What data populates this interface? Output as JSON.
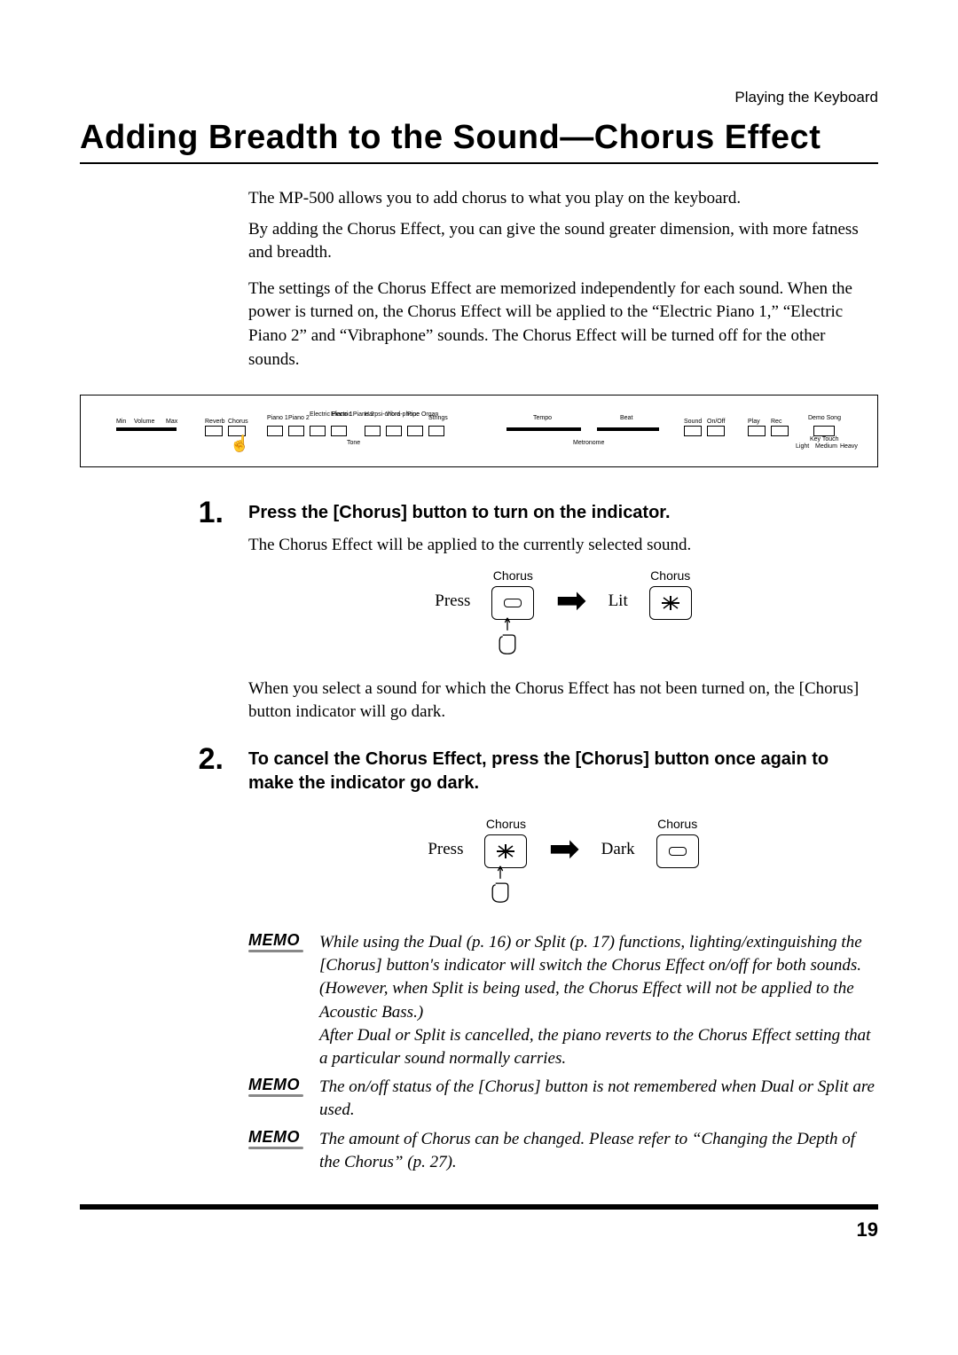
{
  "breadcrumb": "Playing the Keyboard",
  "title": "Adding Breadth to the Sound—Chorus Effect",
  "intro": {
    "p1": "The MP-500 allows you to add chorus to what you play on the keyboard.",
    "p2": "By adding the Chorus Effect, you can give the sound greater dimension, with more fatness and breadth.",
    "p3": "The settings of the Chorus Effect are memorized independently for each sound. When the power is turned on, the Chorus Effect will be applied to the “Electric Piano 1,” “Electric Piano 2” and “Vibraphone” sounds. The Chorus Effect will be turned off for the other sounds."
  },
  "panel": {
    "volume": "Volume",
    "min": "Min",
    "max": "Max",
    "reverb": "Reverb",
    "chorus": "Chorus",
    "tonegroup": "Tone",
    "tones": [
      "Piano 1",
      "Piano 2",
      "Electric Piano 1",
      "Electric Piano 2",
      "Harpsi-chord",
      "Vibra-phone",
      "Pipe Organ",
      "Strings"
    ],
    "tempo": "Tempo",
    "beat": "Beat",
    "metronome": "Metronome",
    "sound": "Sound",
    "onoff": "On/Off",
    "play": "Play",
    "rec": "Rec",
    "demosong": "Demo Song",
    "keytouch": "Key Touch",
    "light": "Light",
    "medium": "Medium",
    "heavy": "Heavy"
  },
  "steps": {
    "s1": {
      "num": "1.",
      "heading": "Press the [Chorus] button to turn on the indicator.",
      "text": "The Chorus Effect will be applied to the currently selected sound.",
      "note": "When you select a sound for which the Chorus Effect has not been turned on, the [Chorus] button indicator will go dark."
    },
    "s2": {
      "num": "2.",
      "heading": "To cancel the Chorus Effect, press the [Chorus] button once again to make the indicator go dark."
    }
  },
  "diagram": {
    "press": "Press",
    "lit": "Lit",
    "dark": "Dark",
    "chorus": "Chorus"
  },
  "memos": {
    "label": "MEMO",
    "m1a": "While using the Dual (p. 16) or Split (p. 17) functions, lighting/extinguishing the [Chorus] button's indicator will switch the Chorus Effect on/off for both sounds. (However, when Split is being used, the Chorus Effect will not be applied to the Acoustic Bass.)",
    "m1b": "After Dual or Split is cancelled, the piano reverts to the Chorus Effect setting that a particular sound normally carries.",
    "m2": "The on/off status of the [Chorus] button is not remembered when Dual or Split are used.",
    "m3": "The amount of Chorus can be changed. Please refer to “Changing the Depth of the Chorus” (p. 27)."
  },
  "page_number": "19"
}
